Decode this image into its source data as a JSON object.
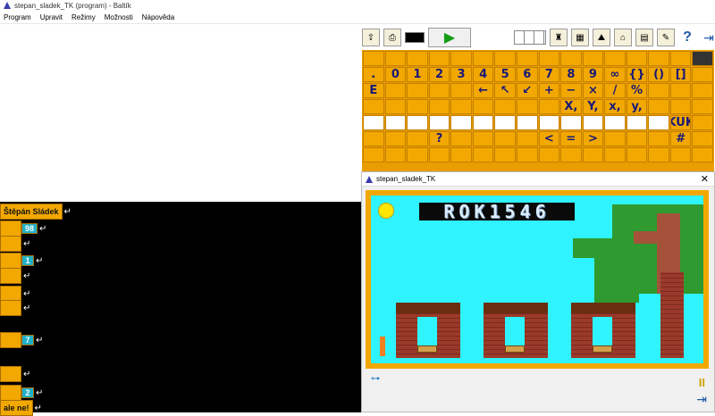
{
  "window": {
    "title": "stepan_sladek_TK (program) - Baltík"
  },
  "menu": [
    "Program",
    "Upravit",
    "Režimy",
    "Možnosti",
    "Nápověda"
  ],
  "toolbar": {
    "run_symbol": "▶",
    "help_symbol": "?",
    "exit_symbol": "⇥"
  },
  "palette": {
    "rows": [
      [
        "",
        "",
        "",
        "",
        "",
        "",
        "",
        "",
        "",
        "",
        "",
        "",
        "",
        "",
        "",
        ""
      ],
      [
        ".",
        "0",
        "1",
        "2",
        "3",
        "4",
        "5",
        "6",
        "7",
        "8",
        "9",
        "∞",
        "{}",
        "()",
        "[]",
        ""
      ],
      [
        "E",
        "",
        "",
        "",
        "",
        "←",
        "↖",
        "↙",
        "+",
        "−",
        "×",
        "/",
        "%",
        "",
        "",
        ""
      ],
      [
        "",
        "",
        "",
        "",
        "",
        "",
        "",
        "",
        "",
        "X,",
        "Y,",
        "x,",
        "y,",
        "",
        "",
        ""
      ],
      [
        "",
        "",
        "",
        "",
        "",
        "",
        "",
        "",
        "",
        "",
        "",
        "",
        "",
        "",
        "KUK",
        ""
      ],
      [
        "",
        "",
        "",
        "?",
        "",
        "",
        "",
        "",
        "<",
        "=",
        ">",
        "",
        "",
        "",
        "#",
        ""
      ],
      [
        "",
        "",
        "",
        "",
        "",
        "",
        "",
        "",
        "",
        "",
        "",
        "",
        "",
        "",
        "",
        ""
      ]
    ]
  },
  "editor": {
    "rows": [
      {
        "label": "Štěpán Sládek",
        "extra": ""
      },
      {
        "label": "",
        "extra": "98"
      },
      {
        "label": "",
        "extra": ""
      },
      {
        "label": "",
        "extra": "1"
      },
      {
        "label": "",
        "extra": ""
      },
      {
        "label": "",
        "extra": ""
      },
      {
        "label": "",
        "extra": ""
      },
      {
        "label": "",
        "extra": "7"
      },
      {
        "label": "",
        "extra": ""
      },
      {
        "label": "",
        "extra": "2"
      },
      {
        "label": "ale ne!",
        "extra": ""
      }
    ],
    "return_symbol": "↵"
  },
  "game_window": {
    "title": "stepan_sladek_TK",
    "close_symbol": "✕",
    "banner": "ROK1546",
    "pause_symbol": "II"
  },
  "colors": {
    "palette_bg": "#e89d00",
    "block": "#f2a800",
    "stage_sky": "#2ff3ff",
    "tree": "#2f9a2f",
    "brick": "#9b3a2a"
  }
}
